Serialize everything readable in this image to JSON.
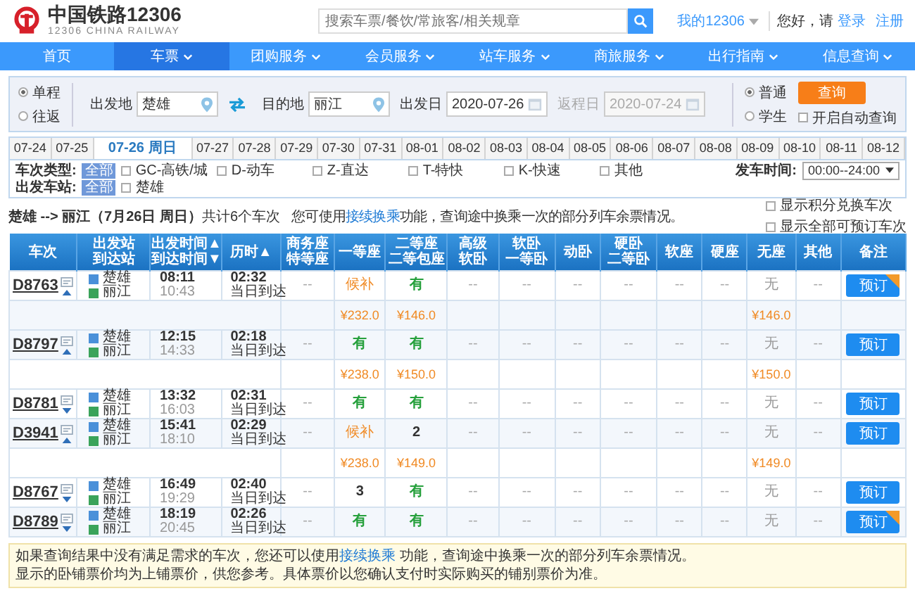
{
  "header": {
    "title": "中国铁路12306",
    "subtitle": "12306 CHINA RAILWAY",
    "search_placeholder": "搜索车票/餐饮/常旅客/相关规章",
    "my_account": "我的12306",
    "greeting": "您好，请",
    "login": "登录",
    "register": "注册"
  },
  "nav": [
    {
      "label": "首页",
      "selected": false,
      "has_menu": false
    },
    {
      "label": "车票",
      "selected": true,
      "has_menu": true
    },
    {
      "label": "团购服务",
      "selected": false,
      "has_menu": true
    },
    {
      "label": "会员服务",
      "selected": false,
      "has_menu": true
    },
    {
      "label": "站车服务",
      "selected": false,
      "has_menu": true
    },
    {
      "label": "商旅服务",
      "selected": false,
      "has_menu": true
    },
    {
      "label": "出行指南",
      "selected": false,
      "has_menu": true
    },
    {
      "label": "信息查询",
      "selected": false,
      "has_menu": true
    }
  ],
  "search": {
    "trip_types": [
      {
        "label": "单程",
        "selected": true
      },
      {
        "label": "往返",
        "selected": false
      }
    ],
    "from": {
      "label": "出发地",
      "value": "楚雄"
    },
    "to": {
      "label": "目的地",
      "value": "丽江"
    },
    "depart_date": {
      "label": "出发日",
      "value": "2020-07-26",
      "disabled": false
    },
    "return_date": {
      "label": "返程日",
      "value": "2020-07-24",
      "disabled": true
    },
    "passenger_types": [
      {
        "label": "普通",
        "selected": true
      },
      {
        "label": "学生",
        "selected": false
      }
    ],
    "query_button": "查询",
    "auto_query": {
      "label": "开启自动查询",
      "checked": false
    }
  },
  "date_tabs": [
    {
      "label": "07-24",
      "selected": false
    },
    {
      "label": "07-25",
      "selected": false
    },
    {
      "label": "07-26 周日",
      "selected": true
    },
    {
      "label": "07-27",
      "selected": false
    },
    {
      "label": "07-28",
      "selected": false
    },
    {
      "label": "07-29",
      "selected": false
    },
    {
      "label": "07-30",
      "selected": false
    },
    {
      "label": "07-31",
      "selected": false
    },
    {
      "label": "08-01",
      "selected": false
    },
    {
      "label": "08-02",
      "selected": false
    },
    {
      "label": "08-03",
      "selected": false
    },
    {
      "label": "08-04",
      "selected": false
    },
    {
      "label": "08-05",
      "selected": false
    },
    {
      "label": "08-06",
      "selected": false
    },
    {
      "label": "08-07",
      "selected": false
    },
    {
      "label": "08-08",
      "selected": false
    },
    {
      "label": "08-09",
      "selected": false
    },
    {
      "label": "08-10",
      "selected": false
    },
    {
      "label": "08-11",
      "selected": false
    },
    {
      "label": "08-12",
      "selected": false
    }
  ],
  "filters": {
    "train_types": {
      "label": "车次类型:",
      "all": {
        "label": "全部",
        "selected": true
      },
      "options": [
        {
          "label": "GC-高铁/城",
          "checked": false
        },
        {
          "label": "D-动车",
          "checked": false
        },
        {
          "label": "Z-直达",
          "checked": false
        },
        {
          "label": "T-特快",
          "checked": false
        },
        {
          "label": "K-快速",
          "checked": false
        },
        {
          "label": "其他",
          "checked": false
        }
      ]
    },
    "time": {
      "label": "发车时间:",
      "value": "00:00--24:00"
    },
    "stations": {
      "label": "出发车站:",
      "all": {
        "label": "全部",
        "selected": true
      },
      "options": [
        {
          "label": "楚雄",
          "checked": false
        }
      ]
    }
  },
  "summary": {
    "route": "**楚雄 --> 丽江（7月26日 周日）**共计6个车次",
    "tip": {
      "before": "您可使用",
      "link": "接续换乘",
      "after": "功能，查询途中换乘一次的部分列车余票情况。"
    },
    "options": [
      {
        "label": "显示积分兑换车次",
        "checked": false
      },
      {
        "label": "显示全部可预订车次",
        "checked": false
      }
    ]
  },
  "table": {
    "columns": [
      {
        "lines": [
          "车次"
        ]
      },
      {
        "lines": [
          "出发站",
          "到达站"
        ]
      },
      {
        "lines": [
          "出发时间▲",
          "到达时间▼"
        ]
      },
      {
        "lines": [
          "历时▲"
        ]
      },
      {
        "lines": [
          "商务座",
          "特等座"
        ]
      },
      {
        "lines": [
          "一等座"
        ]
      },
      {
        "lines": [
          "二等座",
          "二等包座"
        ]
      },
      {
        "lines": [
          "高级",
          "软卧"
        ]
      },
      {
        "lines": [
          "软卧",
          "一等卧"
        ]
      },
      {
        "lines": [
          "动卧"
        ]
      },
      {
        "lines": [
          "硬卧",
          "二等卧"
        ]
      },
      {
        "lines": [
          "软座"
        ]
      },
      {
        "lines": [
          "硬座"
        ]
      },
      {
        "lines": [
          "无座"
        ]
      },
      {
        "lines": [
          "其他"
        ]
      },
      {
        "lines": [
          "备注"
        ]
      }
    ],
    "trains": [
      {
        "code": "D8763",
        "expanded": true,
        "from": "楚雄",
        "to": "丽江",
        "depart": "08:11",
        "arrive": "10:43",
        "duration": "02:32",
        "arrival_day": "当日到达",
        "book": "预订",
        "corner_badge": true,
        "seats": [
          {
            "text": "--",
            "kind": "na"
          },
          {
            "text": "候补",
            "kind": "waitlist",
            "price": "¥232.0"
          },
          {
            "text": "有",
            "kind": "available",
            "price": "¥146.0"
          },
          {
            "text": "--",
            "kind": "na"
          },
          {
            "text": "--",
            "kind": "na"
          },
          {
            "text": "--",
            "kind": "na"
          },
          {
            "text": "--",
            "kind": "na"
          },
          {
            "text": "--",
            "kind": "na"
          },
          {
            "text": "--",
            "kind": "na"
          },
          {
            "text": "无",
            "kind": "none",
            "price": "¥146.0"
          },
          {
            "text": "--",
            "kind": "na"
          }
        ]
      },
      {
        "code": "D8797",
        "expanded": true,
        "from": "楚雄",
        "to": "丽江",
        "depart": "12:15",
        "arrive": "14:33",
        "duration": "02:18",
        "arrival_day": "当日到达",
        "book": "预订",
        "corner_badge": false,
        "seats": [
          {
            "text": "--",
            "kind": "na"
          },
          {
            "text": "有",
            "kind": "available",
            "price": "¥238.0"
          },
          {
            "text": "有",
            "kind": "available",
            "price": "¥150.0"
          },
          {
            "text": "--",
            "kind": "na"
          },
          {
            "text": "--",
            "kind": "na"
          },
          {
            "text": "--",
            "kind": "na"
          },
          {
            "text": "--",
            "kind": "na"
          },
          {
            "text": "--",
            "kind": "na"
          },
          {
            "text": "--",
            "kind": "na"
          },
          {
            "text": "无",
            "kind": "none",
            "price": "¥150.0"
          },
          {
            "text": "--",
            "kind": "na"
          }
        ]
      },
      {
        "code": "D8781",
        "expanded": false,
        "from": "楚雄",
        "to": "丽江",
        "depart": "13:32",
        "arrive": "16:03",
        "duration": "02:31",
        "arrival_day": "当日到达",
        "book": "预订",
        "corner_badge": false,
        "seats": [
          {
            "text": "--",
            "kind": "na"
          },
          {
            "text": "有",
            "kind": "available"
          },
          {
            "text": "有",
            "kind": "available"
          },
          {
            "text": "--",
            "kind": "na"
          },
          {
            "text": "--",
            "kind": "na"
          },
          {
            "text": "--",
            "kind": "na"
          },
          {
            "text": "--",
            "kind": "na"
          },
          {
            "text": "--",
            "kind": "na"
          },
          {
            "text": "--",
            "kind": "na"
          },
          {
            "text": "无",
            "kind": "none"
          },
          {
            "text": "--",
            "kind": "na"
          }
        ]
      },
      {
        "code": "D3941",
        "expanded": true,
        "from": "楚雄",
        "to": "丽江",
        "depart": "15:41",
        "arrive": "18:10",
        "duration": "02:29",
        "arrival_day": "当日到达",
        "book": "预订",
        "corner_badge": false,
        "seats": [
          {
            "text": "--",
            "kind": "na"
          },
          {
            "text": "候补",
            "kind": "waitlist",
            "price": "¥238.0"
          },
          {
            "text": "2",
            "kind": "count",
            "price": "¥149.0"
          },
          {
            "text": "--",
            "kind": "na"
          },
          {
            "text": "--",
            "kind": "na"
          },
          {
            "text": "--",
            "kind": "na"
          },
          {
            "text": "--",
            "kind": "na"
          },
          {
            "text": "--",
            "kind": "na"
          },
          {
            "text": "--",
            "kind": "na"
          },
          {
            "text": "无",
            "kind": "none",
            "price": "¥149.0"
          },
          {
            "text": "--",
            "kind": "na"
          }
        ]
      },
      {
        "code": "D8767",
        "expanded": false,
        "from": "楚雄",
        "to": "丽江",
        "depart": "16:49",
        "arrive": "19:29",
        "duration": "02:40",
        "arrival_day": "当日到达",
        "book": "预订",
        "corner_badge": false,
        "seats": [
          {
            "text": "--",
            "kind": "na"
          },
          {
            "text": "3",
            "kind": "count"
          },
          {
            "text": "有",
            "kind": "available"
          },
          {
            "text": "--",
            "kind": "na"
          },
          {
            "text": "--",
            "kind": "na"
          },
          {
            "text": "--",
            "kind": "na"
          },
          {
            "text": "--",
            "kind": "na"
          },
          {
            "text": "--",
            "kind": "na"
          },
          {
            "text": "--",
            "kind": "na"
          },
          {
            "text": "无",
            "kind": "none"
          },
          {
            "text": "--",
            "kind": "na"
          }
        ]
      },
      {
        "code": "D8789",
        "expanded": false,
        "from": "楚雄",
        "to": "丽江",
        "depart": "18:19",
        "arrive": "20:45",
        "duration": "02:26",
        "arrival_day": "当日到达",
        "book": "预订",
        "corner_badge": true,
        "seats": [
          {
            "text": "--",
            "kind": "na"
          },
          {
            "text": "有",
            "kind": "available"
          },
          {
            "text": "有",
            "kind": "available"
          },
          {
            "text": "--",
            "kind": "na"
          },
          {
            "text": "--",
            "kind": "na"
          },
          {
            "text": "--",
            "kind": "na"
          },
          {
            "text": "--",
            "kind": "na"
          },
          {
            "text": "--",
            "kind": "na"
          },
          {
            "text": "--",
            "kind": "na"
          },
          {
            "text": "无",
            "kind": "none"
          },
          {
            "text": "--",
            "kind": "na"
          }
        ]
      }
    ]
  },
  "notice": {
    "line1": {
      "before": "如果查询结果中没有满足需求的车次，您还可以使用",
      "link": "接续换乘",
      "after": " 功能，查询途中换乘一次的部分列车余票情况。"
    },
    "line2": "显示的卧铺票价均为上铺票价，供您参考。具体票价以您确认支付时实际购买的铺别票价为准。"
  }
}
